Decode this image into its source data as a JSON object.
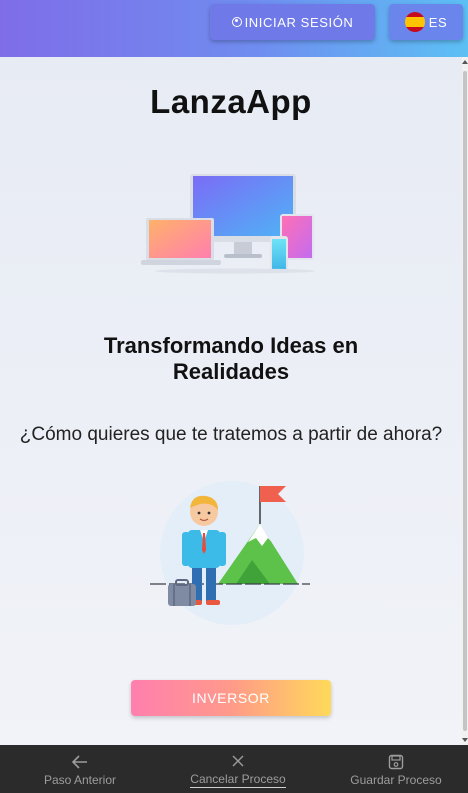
{
  "header": {
    "login_label": "INICIAR SESIÓN",
    "language_label": "ES"
  },
  "main": {
    "app_title": "LanzaApp",
    "tagline_line1": "Transformando Ideas en",
    "tagline_line2": "Realidades",
    "question": "¿Cómo quieres que te tratemos a partir de ahora?",
    "role_button_label": "INVERSOR"
  },
  "bottom_nav": {
    "items": [
      {
        "label": "Paso Anterior",
        "icon": "arrow-left-icon"
      },
      {
        "label": "Cancelar Proceso",
        "icon": "close-icon"
      },
      {
        "label": "Guardar Proceso",
        "icon": "save-icon"
      }
    ]
  },
  "colors": {
    "header_gradient_start": "#7f6de8",
    "header_gradient_end": "#5cc0f4",
    "cta_gradient_start": "#ff7fae",
    "cta_gradient_end": "#ffd95a",
    "bottom_bar": "#2b2b2b"
  }
}
